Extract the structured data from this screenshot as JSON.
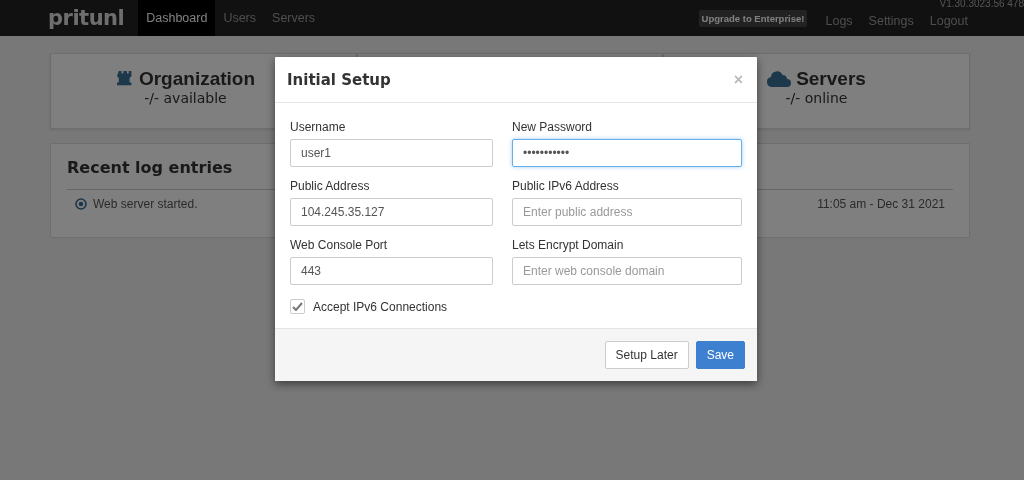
{
  "navbar": {
    "brand": "pritunl",
    "items": [
      {
        "label": "Dashboard",
        "selected": true
      },
      {
        "label": "Users",
        "selected": false
      },
      {
        "label": "Servers",
        "selected": false
      }
    ],
    "upgrade": "Upgrade to Enterprise!",
    "links": [
      "Logs",
      "Settings",
      "Logout"
    ],
    "version": "V1.30.3023.56 478"
  },
  "stats": [
    {
      "kind": "organizations",
      "title": "Organization",
      "subtitle": "-/- available"
    },
    {
      "kind": "hidden"
    },
    {
      "kind": "servers",
      "title": "Servers",
      "subtitle": "-/- online"
    }
  ],
  "log": {
    "title": "Recent log entries",
    "entries": [
      {
        "message": "Web server started.",
        "time": "11:05 am - Dec 31 2021"
      }
    ]
  },
  "modal": {
    "title": "Initial Setup",
    "close": "×",
    "fields": [
      {
        "label": "Username",
        "value": "user1",
        "focused": false
      },
      {
        "label": "New Password",
        "value": "•••••••••••",
        "focused": true
      },
      {
        "label": "Public Address",
        "value": "104.245.35.127",
        "focused": false
      },
      {
        "label": "Public IPv6 Address",
        "placeholder": "Enter public address",
        "focused": false
      },
      {
        "label": "Web Console Port",
        "value": "443",
        "focused": false
      },
      {
        "label": "Lets Encrypt Domain",
        "placeholder": "Enter web console domain",
        "focused": false
      }
    ],
    "checkbox": {
      "label": "Accept IPv6 Connections",
      "checked": true
    },
    "buttons": [
      {
        "kind": "default",
        "label": "Setup Later"
      },
      {
        "kind": "primary",
        "label": "Save"
      }
    ]
  }
}
